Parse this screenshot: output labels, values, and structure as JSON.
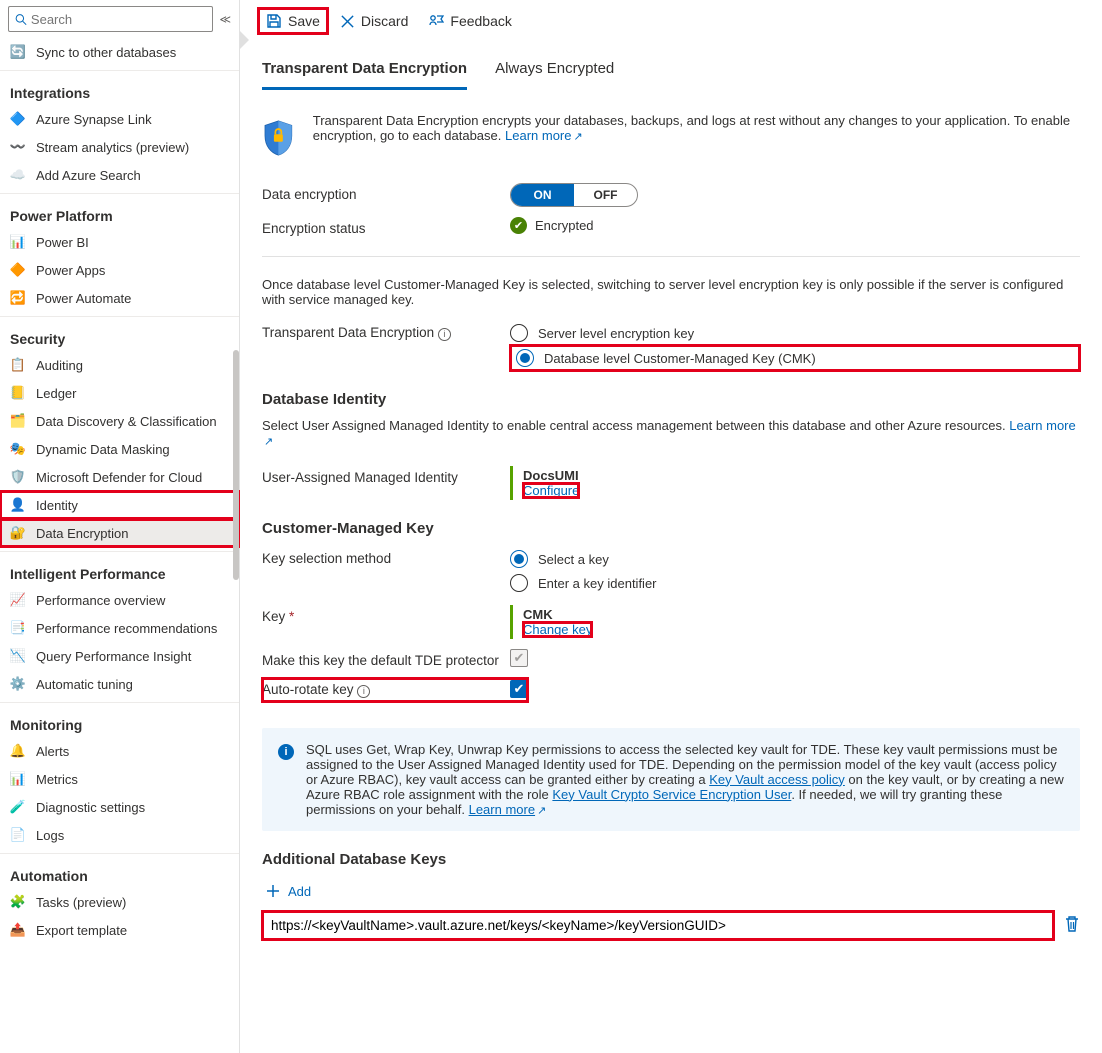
{
  "search_placeholder": "Search",
  "sidebar": {
    "top": "Sync to other databases",
    "groups": [
      {
        "title": "Integrations",
        "items": [
          "Azure Synapse Link",
          "Stream analytics (preview)",
          "Add Azure Search"
        ]
      },
      {
        "title": "Power Platform",
        "items": [
          "Power BI",
          "Power Apps",
          "Power Automate"
        ]
      },
      {
        "title": "Security",
        "items": [
          "Auditing",
          "Ledger",
          "Data Discovery & Classification",
          "Dynamic Data Masking",
          "Microsoft Defender for Cloud",
          "Identity",
          "Data Encryption"
        ]
      },
      {
        "title": "Intelligent Performance",
        "items": [
          "Performance overview",
          "Performance recommendations",
          "Query Performance Insight",
          "Automatic tuning"
        ]
      },
      {
        "title": "Monitoring",
        "items": [
          "Alerts",
          "Metrics",
          "Diagnostic settings",
          "Logs"
        ]
      },
      {
        "title": "Automation",
        "items": [
          "Tasks (preview)",
          "Export template"
        ]
      }
    ]
  },
  "toolbar": {
    "save": "Save",
    "discard": "Discard",
    "feedback": "Feedback"
  },
  "tabs": {
    "tde": "Transparent Data Encryption",
    "ae": "Always Encrypted"
  },
  "intro": {
    "text": "Transparent Data Encryption encrypts your databases, backups, and logs at rest without any changes to your application. To enable encryption, go to each database.",
    "learn": "Learn more"
  },
  "labels": {
    "data_encryption": "Data encryption",
    "encryption_status": "Encryption status",
    "on": "ON",
    "off": "OFF",
    "encrypted": "Encrypted",
    "cmk_note": "Once database level Customer-Managed Key is selected, switching to server level encryption key is only possible if the server is configured with service managed key.",
    "tde_label": "Transparent Data Encryption",
    "radio_server": "Server level encryption key",
    "radio_db": "Database level Customer-Managed Key (CMK)",
    "db_identity": "Database Identity",
    "db_identity_desc": "Select User Assigned Managed Identity to enable central access management between this database and other Azure resources.",
    "learn_more": "Learn more",
    "uami": "User-Assigned Managed Identity",
    "uami_val": "DocsUMI",
    "configure": "Configure",
    "cmk_head": "Customer-Managed Key",
    "key_sel": "Key selection method",
    "select_key": "Select a key",
    "enter_key": "Enter a key identifier",
    "key": "Key",
    "key_val": "CMK",
    "change_key": "Change key",
    "default_protector": "Make this key the default TDE protector",
    "auto_rotate": "Auto-rotate key",
    "callout": {
      "p1": "SQL uses Get, Wrap Key, Unwrap Key permissions to access the selected key vault for TDE. These key vault permissions must be assigned to the User Assigned Managed Identity used for TDE. Depending on the permission model of the key vault (access policy or Azure RBAC), key vault access can be granted either by creating a ",
      "l1": "Key Vault access policy",
      "p2": " on the key vault, or by creating a new Azure RBAC role assignment with the role ",
      "l2": "Key Vault Crypto Service Encryption User",
      "p3": ". If needed, we will try granting these permissions on your behalf. ",
      "l3": "Learn more"
    },
    "addl_keys": "Additional Database Keys",
    "add": "Add",
    "key_uri": "https://<keyVaultName>.vault.azure.net/keys/<keyName>/keyVersionGUID>"
  }
}
